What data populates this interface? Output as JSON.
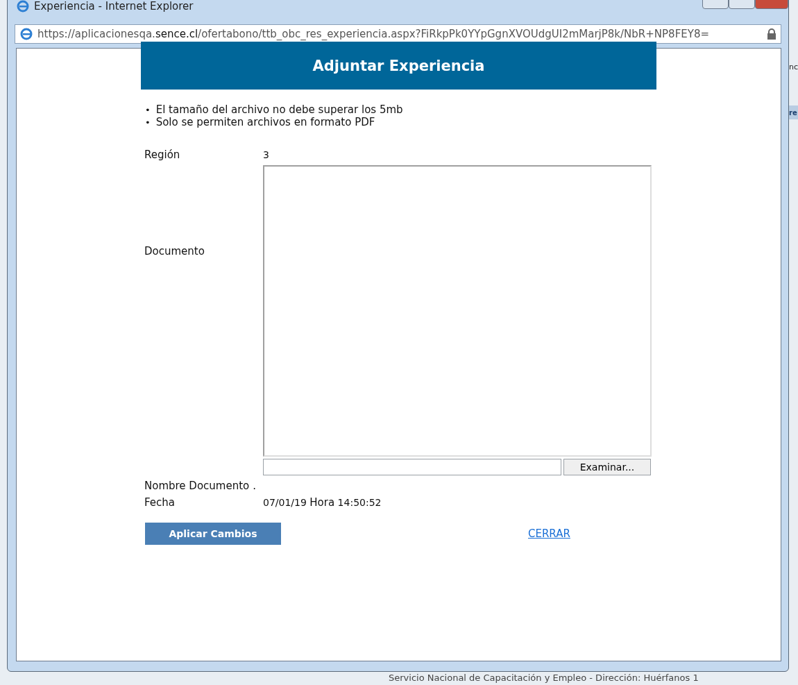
{
  "background": {
    "right_texts": [
      "nc",
      "re"
    ],
    "footer": "Servicio Nacional de Capacitación y Empleo - Dirección: Huérfanos 1"
  },
  "window": {
    "title": "Experiencia - Internet Explorer",
    "url_host_prefix": "https://aplicacionesqa.",
    "url_host_domain": "sence.cl",
    "url_path": "/ofertabono/ttb_obc_res_experiencia.aspx?FiRkpPk0YYpGgnXVOUdgUI2mMarjP8k/NbR+NP8FEY8="
  },
  "page": {
    "heading": "Adjuntar Experiencia",
    "notes": [
      {
        "marker": "•",
        "text": "El tamaño del archivo no debe superar los 5mb"
      },
      {
        "marker": "•",
        "text": "Solo se permiten archivos en formato PDF"
      }
    ],
    "fields": [
      {
        "kind": "text",
        "label": "Región",
        "value": "3"
      },
      {
        "kind": "upload",
        "label": "Documento",
        "browse_button": "Examinar..."
      },
      {
        "kind": "text",
        "label": "Nombre Documento",
        "value": "."
      },
      {
        "kind": "datetime",
        "label": "Fecha",
        "date": "07/01/19",
        "time_label": "Hora",
        "time": "14:50:52"
      }
    ],
    "apply_button": "Aplicar Cambios",
    "close_link": "CERRAR"
  }
}
